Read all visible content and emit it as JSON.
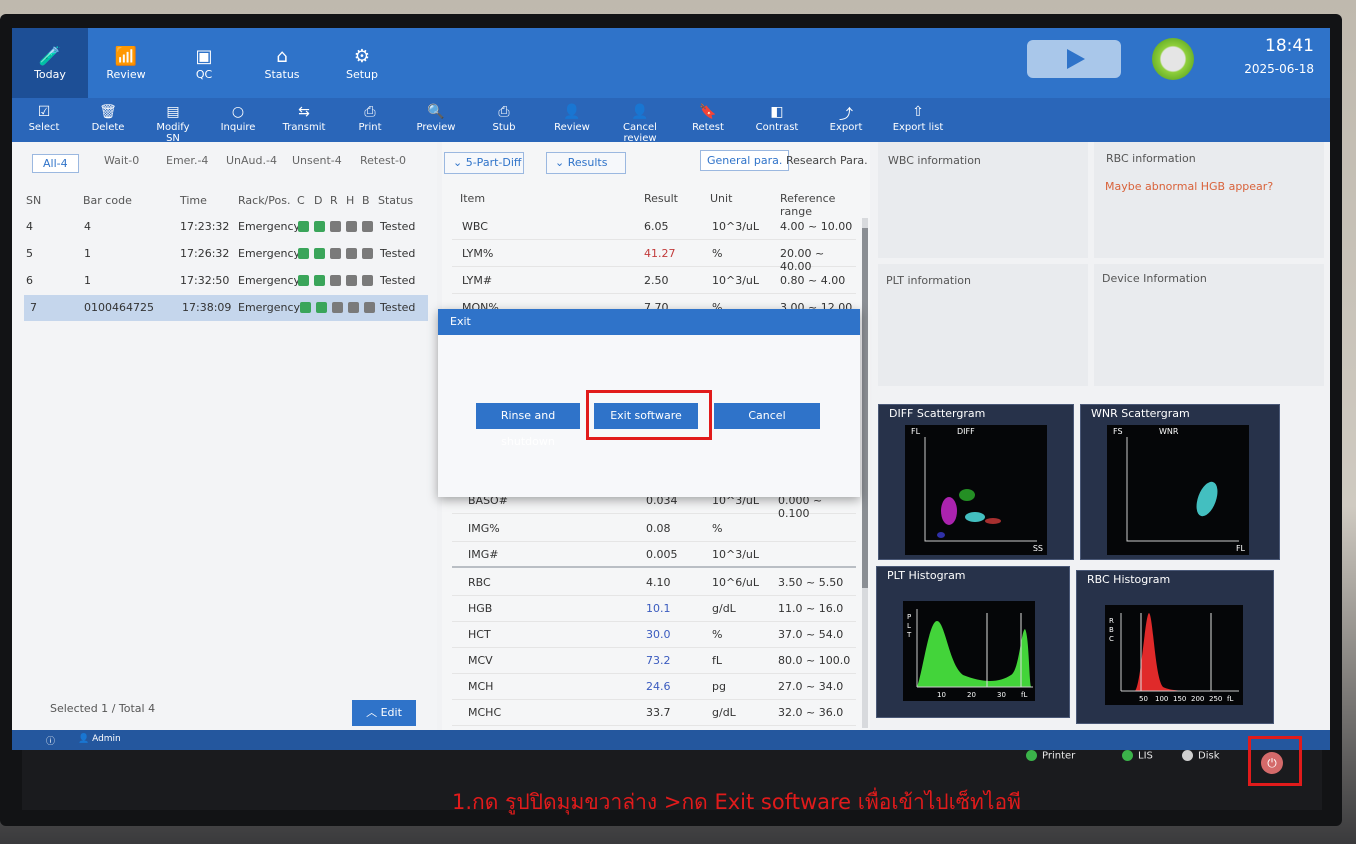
{
  "tabs": [
    {
      "label": "Today",
      "icon": "flask-icon"
    },
    {
      "label": "Review",
      "icon": "bar-chart-icon"
    },
    {
      "label": "QC",
      "icon": "monitor-icon"
    },
    {
      "label": "Status",
      "icon": "home-icon"
    },
    {
      "label": "Setup",
      "icon": "gear-icon"
    }
  ],
  "clock": {
    "time": "18:41",
    "date": "2025-06-18"
  },
  "toolbar": [
    {
      "label": "Select",
      "icon": "select-icon"
    },
    {
      "label": "Delete",
      "icon": "trash-icon"
    },
    {
      "label": "Modify SN",
      "icon": "edit-sn-icon"
    },
    {
      "label": "Inquire",
      "icon": "search-icon"
    },
    {
      "label": "Transmit",
      "icon": "transfer-icon"
    },
    {
      "label": "Print",
      "icon": "printer-icon"
    },
    {
      "label": "Preview",
      "icon": "preview-icon"
    },
    {
      "label": "Stub",
      "icon": "printer-icon"
    },
    {
      "label": "Review",
      "icon": "user-check-icon"
    },
    {
      "label": "Cancel review",
      "icon": "user-cancel-icon"
    },
    {
      "label": "Retest",
      "icon": "bookmark-icon"
    },
    {
      "label": "Contrast",
      "icon": "contrast-icon"
    },
    {
      "label": "Export",
      "icon": "export-icon"
    },
    {
      "label": "Export list",
      "icon": "upload-icon"
    }
  ],
  "filters": [
    "All-4",
    "Wait-0",
    "Emer.-4",
    "UnAud.-4",
    "Unsent-4",
    "Retest-0"
  ],
  "table": {
    "headers": [
      "SN",
      "Bar code",
      "Time",
      "Rack/Pos.",
      "C",
      "D",
      "R",
      "H",
      "B",
      "Status"
    ],
    "rows": [
      {
        "sn": "4",
        "barcode": "4",
        "time": "17:23:32",
        "rack": "Emergency",
        "status": "Tested"
      },
      {
        "sn": "5",
        "barcode": "1",
        "time": "17:26:32",
        "rack": "Emergency",
        "status": "Tested"
      },
      {
        "sn": "6",
        "barcode": "1",
        "time": "17:32:50",
        "rack": "Emergency",
        "status": "Tested"
      },
      {
        "sn": "7",
        "barcode": "0100464725",
        "time": "17:38:09",
        "rack": "Emergency",
        "status": "Tested"
      }
    ]
  },
  "footer": {
    "selected": "Selected 1",
    "sep": "/",
    "total": "Total 4",
    "edit": "Edit"
  },
  "results_panel": {
    "diff_mode": "5-Part-Diff",
    "view": "Results",
    "general_para": "General para.",
    "research_para": "Research Para.",
    "headers": [
      "Item",
      "Result",
      "Unit",
      "Reference range"
    ],
    "rows_top": [
      {
        "item": "WBC",
        "result": "6.05",
        "unit": "10^3/uL",
        "range": "4.00 ~ 10.00"
      },
      {
        "item": "LYM%",
        "result": "41.27",
        "unit": "%",
        "range": "20.00 ~ 40.00"
      },
      {
        "item": "LYM#",
        "result": "2.50",
        "unit": "10^3/uL",
        "range": "0.80 ~ 4.00"
      },
      {
        "item": "MON%",
        "result": "7.70",
        "unit": "%",
        "range": "3.00 ~ 12.00"
      }
    ],
    "rows_bottom": [
      {
        "item": "BASO#",
        "result": "0.034",
        "unit": "10^3/uL",
        "range": "0.000 ~ 0.100"
      },
      {
        "item": "IMG%",
        "result": "0.08",
        "unit": "%",
        "range": ""
      },
      {
        "item": "IMG#",
        "result": "0.005",
        "unit": "10^3/uL",
        "range": ""
      },
      {
        "item": "RBC",
        "result": "4.10",
        "unit": "10^6/uL",
        "range": "3.50 ~ 5.50"
      },
      {
        "item": "HGB",
        "result": "10.1",
        "unit": "g/dL",
        "range": "11.0 ~ 16.0"
      },
      {
        "item": "HCT",
        "result": "30.0",
        "unit": "%",
        "range": "37.0 ~ 54.0"
      },
      {
        "item": "MCV",
        "result": "73.2",
        "unit": "fL",
        "range": "80.0 ~ 100.0"
      },
      {
        "item": "MCH",
        "result": "24.6",
        "unit": "pg",
        "range": "27.0 ~ 34.0"
      },
      {
        "item": "MCHC",
        "result": "33.7",
        "unit": "g/dL",
        "range": "32.0 ~ 36.0"
      }
    ]
  },
  "info": {
    "wbc": "WBC information",
    "rbc": "RBC information",
    "rbc_warning": "Maybe abnormal HGB appear?",
    "plt": "PLT information",
    "device": "Device Information"
  },
  "graphs": {
    "diff": {
      "title": "DIFF Scattergram",
      "y": "FL",
      "label": "DIFF",
      "x": "SS"
    },
    "wnr": {
      "title": "WNR Scattergram",
      "y": "FS",
      "label": "WNR",
      "x": "FL"
    },
    "plt": {
      "title": "PLT Histogram",
      "y": "P L T",
      "ticks": [
        "10",
        "20",
        "30",
        "fL"
      ]
    },
    "rbc": {
      "title": "RBC Histogram",
      "y": "R B C",
      "ticks": [
        "50",
        "100",
        "150",
        "200",
        "250",
        "fL"
      ]
    }
  },
  "status": {
    "user": "Admin",
    "printer": "Printer",
    "lis": "LIS",
    "disk": "Disk"
  },
  "modal": {
    "title": "Exit",
    "rinse": "Rinse and shutdown",
    "exit": "Exit software",
    "cancel": "Cancel"
  },
  "caption": "1.กด รูปปิดมุมขวาล่าง >กด Exit software เพื่อเข้าไปเซ็ทไอพี",
  "colors": {
    "primary": "#2f73c9",
    "annotation": "#e11b1b",
    "abnormal_high": "#c23b3b",
    "abnormal_low": "#3a5bbf"
  }
}
